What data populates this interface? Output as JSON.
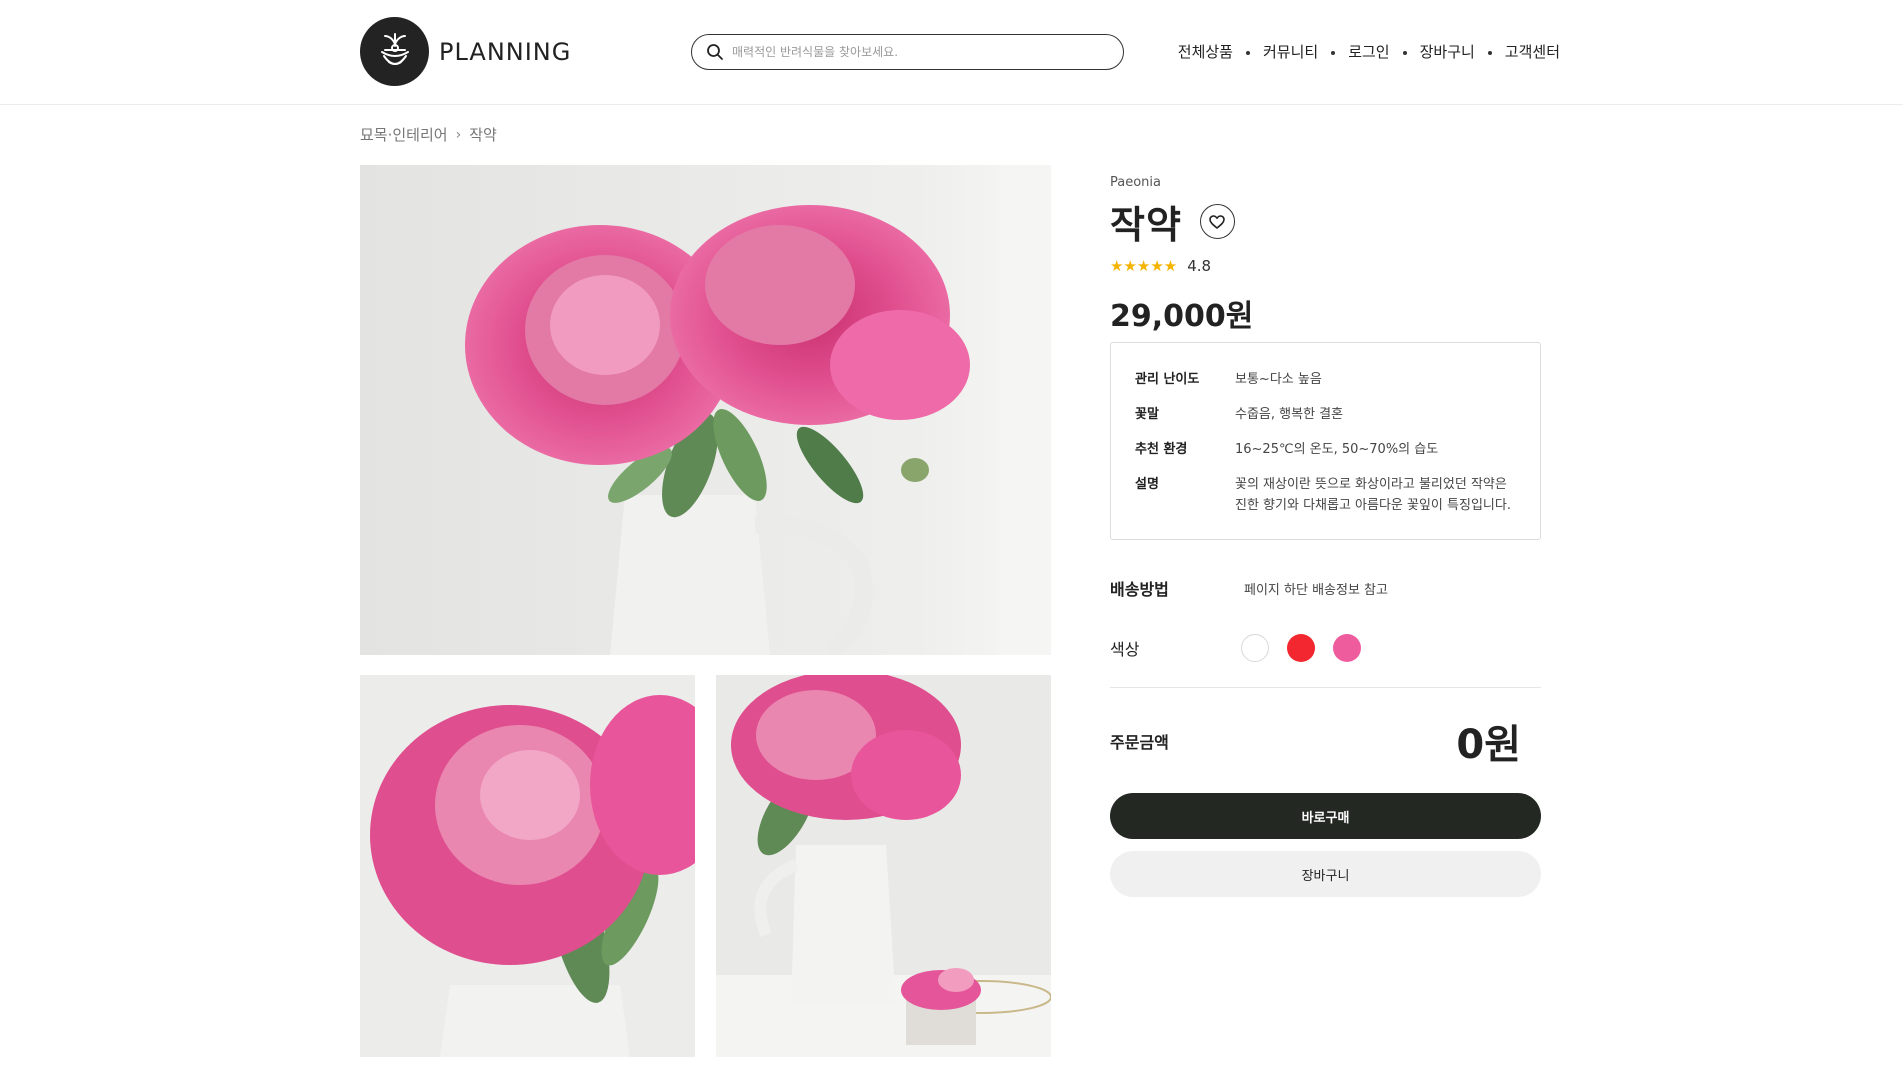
{
  "header": {
    "logo_text": "PLANNING",
    "search_placeholder": "매력적인 반려식물을 찾아보세요.",
    "nav": [
      "전체상품",
      "커뮤니티",
      "로그인",
      "장바구니",
      "고객센터"
    ]
  },
  "breadcrumb": {
    "category": "묘목·인테리어",
    "current": "작약"
  },
  "product": {
    "latin_name": "Paeonia",
    "name": "작약",
    "stars": "★★★★★",
    "rating": "4.8",
    "price": "29,000원",
    "specs": [
      {
        "key": "관리 난이도",
        "value": "보통~다소 높음"
      },
      {
        "key": "꽃말",
        "value": "수줍음, 행복한 결혼"
      },
      {
        "key": "추천 환경",
        "value": "16~25℃의 온도, 50~70%의 습도"
      },
      {
        "key": "설명",
        "value": "꽃의 재상이란 뜻으로 화상이라고 불리었던 작약은 진한 향기와 다채롭고 아름다운 꽃잎이 특징입니다."
      }
    ],
    "shipping_label": "배송방법",
    "shipping_value": "페이지 하단 배송정보 참고",
    "color_label": "색상",
    "colors": [
      "#ffffff",
      "#f2272f",
      "#ef5c9e"
    ],
    "total_label": "주문금액",
    "total_value": "0원",
    "buy_label": "바로구매",
    "cart_label": "장바구니"
  },
  "icons": {
    "search": "search-icon",
    "heart": "heart-icon",
    "logo": "plant-pot-logo-icon"
  },
  "colors": {
    "primary_dark": "#232823",
    "star": "#f5b400",
    "button_light": "#f0f0f0"
  }
}
